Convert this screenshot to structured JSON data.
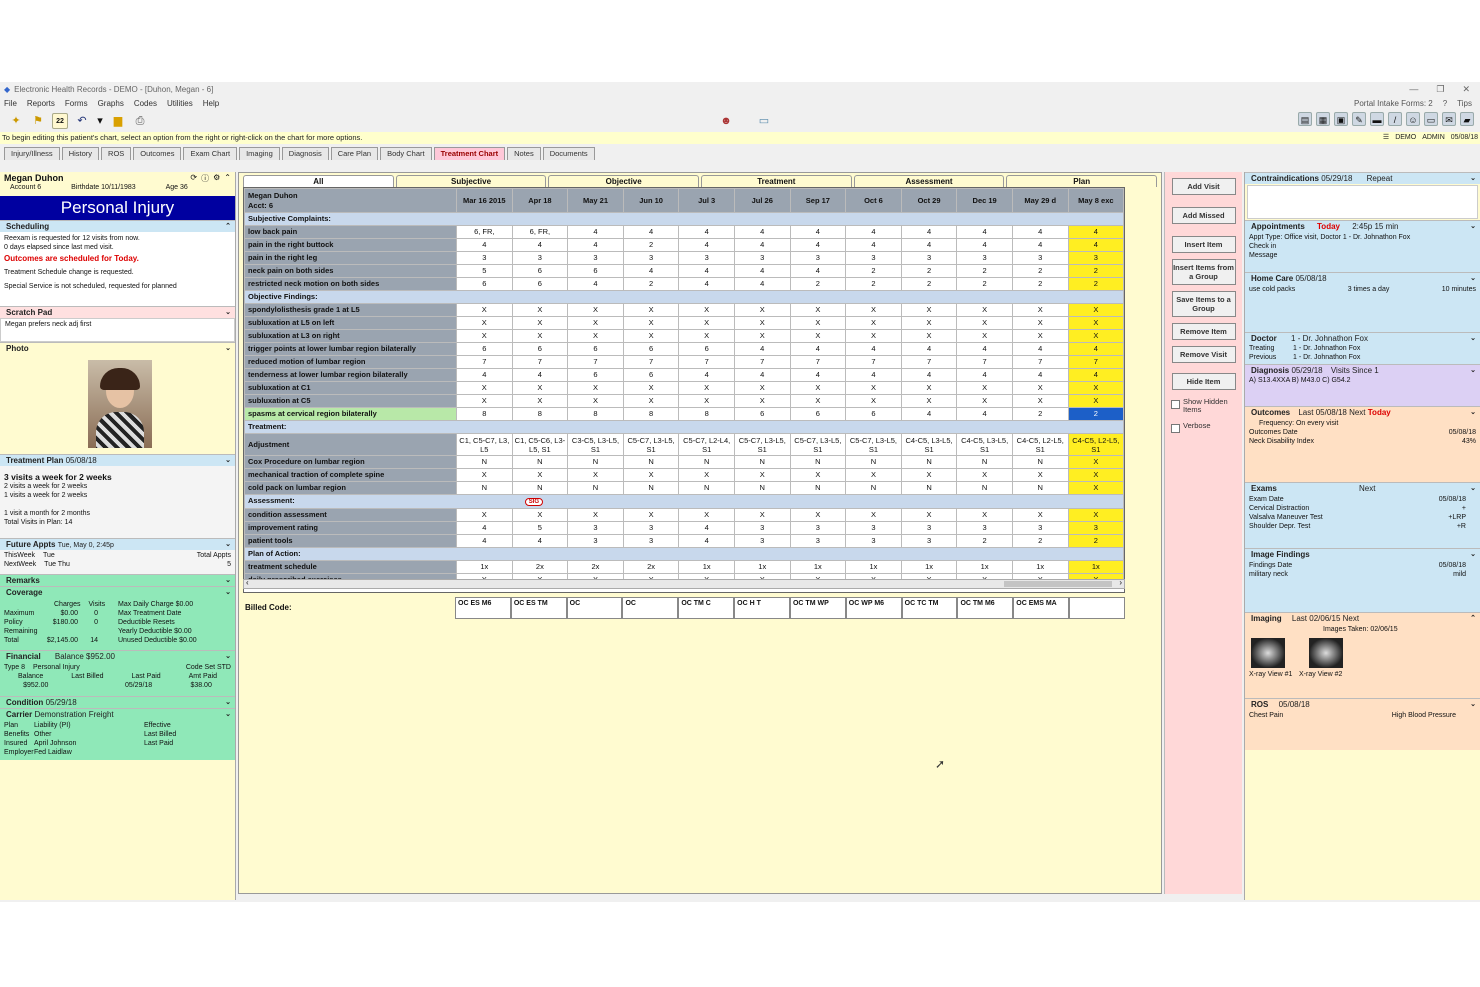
{
  "window": {
    "title": "Electronic Health Records - DEMO - [Duhon, Megan - 6]"
  },
  "menu": [
    "File",
    "Reports",
    "Forms",
    "Graphs",
    "Codes",
    "Utilities",
    "Help"
  ],
  "menu_right": [
    "Portal Intake Forms: 2",
    "Tips"
  ],
  "toolbar_date": "22",
  "infobar": "To begin editing this patient's chart, select an option from the right or right-click on the chart for more options.",
  "status": [
    "DEMO",
    "ADMIN",
    "05/08/18"
  ],
  "tabs": [
    "Injury/Illness",
    "History",
    "ROS",
    "Outcomes",
    "Exam Chart",
    "Imaging",
    "Diagnosis",
    "Care Plan",
    "Body Chart",
    "Treatment Chart",
    "Notes",
    "Documents"
  ],
  "patient": {
    "name": "Megan Duhon",
    "account": "Account 6",
    "birthdate": "Birthdate 10/11/1983",
    "age": "Age 36",
    "case": "Personal Injury"
  },
  "scheduling": {
    "title": "Scheduling",
    "items": [
      "Reexam is requested for 12 visits from now.",
      "0 days elapsed since last med visit.",
      "Outcomes are scheduled for Today.",
      "Treatment Schedule change is requested.",
      "Special Service is not scheduled, requested for planned"
    ]
  },
  "scratch": {
    "title": "Scratch Pad",
    "text": "Megan prefers neck adj first"
  },
  "photo_title": "Photo",
  "plan": {
    "title": "Treatment Plan",
    "date": "05/08/18",
    "lines": [
      "3 visits a week for 2 weeks",
      "2 visits a week for 2 weeks",
      "1 visits a week for 2 weeks",
      "",
      "1 visit a month for 2 months",
      "Total Visits in Plan: 14"
    ]
  },
  "future": {
    "title": "Future Appts",
    "next": "Tue, May 0, 2:45p",
    "total_label": "Total Appts",
    "total": "5",
    "rows": [
      [
        "ThisWeek",
        "Tue"
      ],
      [
        "NextWeek",
        "Tue Thu"
      ]
    ]
  },
  "remarks_title": "Remarks",
  "coverage": {
    "title": "Coverage",
    "cols": [
      "Charges",
      "Visits"
    ],
    "rows": [
      [
        "Maximum",
        "$0.00",
        "0"
      ],
      [
        "Policy",
        "$180.00",
        "0"
      ],
      [
        "Remaining",
        ""
      ],
      [
        "Total",
        "$2,145.00",
        "14"
      ]
    ],
    "right": [
      "Max Daily Charge $0.00",
      "Max Treatment Date",
      "Deductible Resets",
      "Yearly Deductible $0.00",
      "Unused Deductible $0.00"
    ]
  },
  "financial": {
    "title": "Financial",
    "balance": "Balance $952.00",
    "type": "Type 8",
    "case": "Personal Injury",
    "code_set": "Code Set STD",
    "heads": [
      "Balance",
      "Last Billed",
      "Last Paid",
      "Amt Paid"
    ],
    "vals": [
      "$952.00",
      "",
      "05/29/18",
      "$38.00"
    ]
  },
  "condition": {
    "title": "Condition",
    "date": "05/29/18"
  },
  "carrier": {
    "title": "Carrier",
    "name": "Demonstration Freight",
    "rows": [
      [
        "Plan",
        "Liability (PI)",
        "Effective"
      ],
      [
        "Benefits",
        "Other",
        "Last Billed"
      ],
      [
        "Insured",
        "April Johnson",
        "Last Paid"
      ],
      [
        "Employer",
        "Fed Laidlaw",
        ""
      ]
    ]
  },
  "chart_tabs": [
    "All",
    "Subjective",
    "Objective",
    "Treatment",
    "Assessment",
    "Plan"
  ],
  "grid": {
    "patient_name": "Megan Duhon",
    "acct": "Acct: 6",
    "dates": [
      "Mar 16 2015",
      "Apr 18",
      "May 21",
      "Jun 10",
      "Jul 3",
      "Jul 26",
      "Sep 17",
      "Oct 6",
      "Oct 29",
      "Dec 19",
      "May 29 d",
      "May 8 exc"
    ],
    "rows": [
      {
        "section": "Subjective Complaints:"
      },
      {
        "label": "low back pain",
        "v": [
          "6, FR,",
          "6, FR,",
          "4",
          "4",
          "4",
          "4",
          "4",
          "4",
          "4",
          "4",
          "4",
          "4"
        ]
      },
      {
        "label": "pain in the right buttock",
        "v": [
          "4",
          "4",
          "4",
          "2",
          "4",
          "4",
          "4",
          "4",
          "4",
          "4",
          "4",
          "4"
        ]
      },
      {
        "label": "pain in the right leg",
        "v": [
          "3",
          "3",
          "3",
          "3",
          "3",
          "3",
          "3",
          "3",
          "3",
          "3",
          "3",
          "3"
        ]
      },
      {
        "label": "neck pain on both sides",
        "v": [
          "5",
          "6",
          "6",
          "4",
          "4",
          "4",
          "4",
          "2",
          "2",
          "2",
          "2",
          "2"
        ]
      },
      {
        "label": "restricted neck motion on both sides",
        "v": [
          "6",
          "6",
          "4",
          "2",
          "4",
          "4",
          "2",
          "2",
          "2",
          "2",
          "2",
          "2"
        ]
      },
      {
        "section": "Objective Findings:"
      },
      {
        "label": "spondylolisthesis grade 1 at L5",
        "v": [
          "X",
          "X",
          "X",
          "X",
          "X",
          "X",
          "X",
          "X",
          "X",
          "X",
          "X",
          "X"
        ]
      },
      {
        "label": "subluxation at L5 on left",
        "v": [
          "X",
          "X",
          "X",
          "X",
          "X",
          "X",
          "X",
          "X",
          "X",
          "X",
          "X",
          "X"
        ]
      },
      {
        "label": "subluxation at L3 on right",
        "v": [
          "X",
          "X",
          "X",
          "X",
          "X",
          "X",
          "X",
          "X",
          "X",
          "X",
          "X",
          "X"
        ]
      },
      {
        "label": "trigger points at lower lumbar region bilaterally",
        "v": [
          "6",
          "6",
          "6",
          "6",
          "6",
          "4",
          "4",
          "4",
          "4",
          "4",
          "4",
          "4"
        ]
      },
      {
        "label": "reduced motion of lumbar region",
        "v": [
          "7",
          "7",
          "7",
          "7",
          "7",
          "7",
          "7",
          "7",
          "7",
          "7",
          "7",
          "7"
        ]
      },
      {
        "label": "tenderness at lower lumbar region bilaterally",
        "v": [
          "4",
          "4",
          "6",
          "6",
          "4",
          "4",
          "4",
          "4",
          "4",
          "4",
          "4",
          "4"
        ]
      },
      {
        "label": "subluxation at C1",
        "v": [
          "X",
          "X",
          "X",
          "X",
          "X",
          "X",
          "X",
          "X",
          "X",
          "X",
          "X",
          "X"
        ]
      },
      {
        "label": "subluxation at C5",
        "v": [
          "X",
          "X",
          "X",
          "X",
          "X",
          "X",
          "X",
          "X",
          "X",
          "X",
          "X",
          "X"
        ]
      },
      {
        "label": "spasms at cervical region bilaterally",
        "hl": true,
        "v": [
          "8",
          "8",
          "8",
          "8",
          "8",
          "6",
          "6",
          "6",
          "4",
          "4",
          "2",
          "2"
        ]
      },
      {
        "section": "Treatment:"
      },
      {
        "label": "Adjustment",
        "adj": true,
        "v": [
          "C1, C5-C7, L3, L5",
          "C1, C5-C6, L3-L5, S1",
          "C3-C5, L3-L5, S1",
          "C5-C7, L3-L5, S1",
          "C5-C7, L2-L4, S1",
          "C5-C7, L3-L5, S1",
          "C5-C7, L3-L5, S1",
          "C5-C7, L3-L5, S1",
          "C4-C5, L3-L5, S1",
          "C4-C5, L3-L5, S1",
          "C4-C5, L2-L5, S1",
          "C4-C5, L2-L5, S1"
        ]
      },
      {
        "label": "Cox Procedure on lumbar region",
        "v": [
          "N",
          "N",
          "N",
          "N",
          "N",
          "N",
          "N",
          "N",
          "N",
          "N",
          "N",
          "X"
        ]
      },
      {
        "label": "mechanical traction of complete spine",
        "v": [
          "X",
          "X",
          "X",
          "X",
          "X",
          "X",
          "X",
          "X",
          "X",
          "X",
          "X",
          "X"
        ]
      },
      {
        "label": "cold pack on lumbar region",
        "v": [
          "N",
          "N",
          "N",
          "N",
          "N",
          "N",
          "N",
          "N",
          "N",
          "N",
          "N",
          "X"
        ]
      },
      {
        "section": "Assessment:",
        "mark": "SIG"
      },
      {
        "label": "condition assessment",
        "v": [
          "X",
          "X",
          "X",
          "X",
          "X",
          "X",
          "X",
          "X",
          "X",
          "X",
          "X",
          "X"
        ]
      },
      {
        "label": "improvement rating",
        "v": [
          "4",
          "5",
          "3",
          "3",
          "4",
          "3",
          "3",
          "3",
          "3",
          "3",
          "3",
          "3"
        ]
      },
      {
        "label": "patient tools",
        "v": [
          "4",
          "4",
          "3",
          "3",
          "4",
          "3",
          "3",
          "3",
          "3",
          "2",
          "2",
          "2"
        ]
      },
      {
        "section": "Plan of Action:"
      },
      {
        "label": "treatment schedule",
        "v": [
          "1x",
          "2x",
          "2x",
          "2x",
          "1x",
          "1x",
          "1x",
          "1x",
          "1x",
          "1x",
          "1x",
          "1x"
        ]
      },
      {
        "label": "daily prescribed exercises",
        "v": [
          "X",
          "X",
          "X",
          "X",
          "X",
          "X",
          "X",
          "X",
          "X",
          "X",
          "X",
          "X"
        ]
      }
    ]
  },
  "billed": {
    "label": "Billed Code:",
    "codes": [
      "OC ES M6",
      "OC ES TM",
      "OC",
      "OC",
      "OC TM C",
      "OC H T",
      "OC TM WP",
      "OC WP M6",
      "OC TC TM",
      "OC TM M6",
      "OC EMS MA",
      ""
    ]
  },
  "actions": [
    "Add Visit",
    "Add Missed",
    "Insert Item",
    "Insert Items from a Group",
    "Save Items to a Group",
    "Remove Item",
    "Remove Visit",
    "Hide Item"
  ],
  "checks": [
    "Show Hidden Items",
    "Verbose"
  ],
  "right": {
    "contra": {
      "title": "Contraindications",
      "date": "05/29/18",
      "opt": "Repeat"
    },
    "appts": {
      "title": "Appointments",
      "today": "Today",
      "time": "2:45p 15 min",
      "lines": [
        "Appt Type: Office visit, Doctor 1 - Dr. Johnathon Fox",
        "Check in",
        "Message"
      ]
    },
    "homecare": {
      "title": "Home Care",
      "date": "05/08/18",
      "row": [
        "use cold packs",
        "3 times a day",
        "10 minutes"
      ]
    },
    "doctor": {
      "title": "Doctor",
      "rows": [
        [
          "Treating",
          "1 - Dr. Johnathon Fox"
        ],
        [
          "Previous",
          "1 - Dr. Johnathon Fox"
        ],
        [
          "",
          "1 - Dr. Johnathon Fox"
        ]
      ]
    },
    "dx": {
      "title": "Diagnosis",
      "date": "05/29/18",
      "visits": "Visits Since 1",
      "codes": "A) S13.4XXA  B) M43.0  C) G54.2"
    },
    "outcomes": {
      "title": "Outcomes",
      "last": "Last 05/08/18",
      "next": "Next",
      "today": "Today",
      "freq": "Frequency: On every visit",
      "rows": [
        [
          "Outcomes Date",
          "05/08/18"
        ],
        [
          "Neck Disability Index",
          "43%"
        ]
      ]
    },
    "exams": {
      "title": "Exams",
      "next": "Next",
      "rows": [
        [
          "Exam Date",
          "05/08/18"
        ],
        [
          "Cervical Distraction",
          "+"
        ],
        [
          "Valsalva Maneuver Test",
          "+LRP"
        ],
        [
          "Shoulder Depr. Test",
          "+R"
        ]
      ]
    },
    "imgfind": {
      "title": "Image Findings",
      "rows": [
        [
          "Findings Date",
          "05/08/18"
        ],
        [
          "military neck",
          "mild"
        ]
      ]
    },
    "imaging": {
      "title": "Imaging",
      "last": "Last 02/06/15",
      "next": "Next",
      "taken": "Images Taken: 02/06/15",
      "thumbs": [
        "X-ray View #1",
        "X-ray View #2"
      ]
    },
    "ros": {
      "title": "ROS",
      "date": "05/08/18",
      "items": [
        "Chest Pain",
        "High Blood Pressure"
      ]
    }
  },
  "colors": {
    "accent": "#0000a0",
    "today": "#ffee22",
    "tab_active": "#ffc8d8",
    "grid_label": "#9aa4b0"
  }
}
